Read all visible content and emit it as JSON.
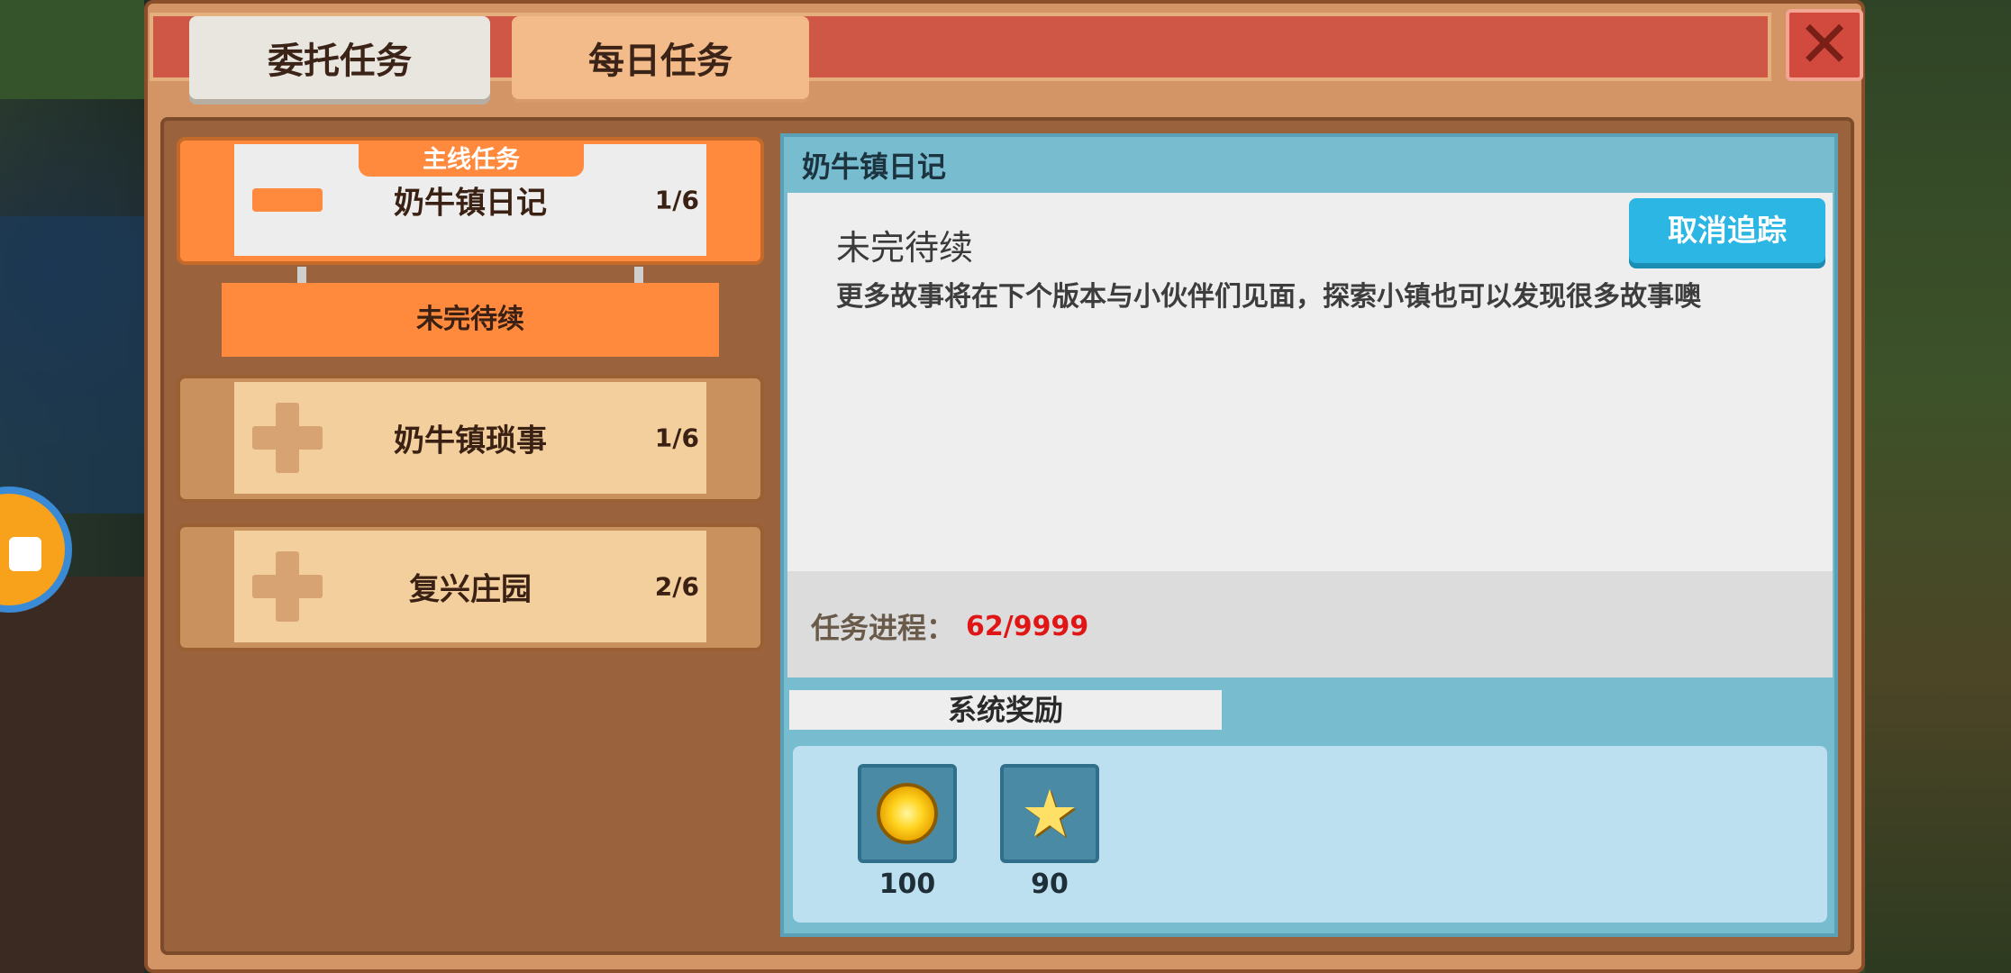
{
  "tabs": [
    {
      "label": "委托任务",
      "active": true
    },
    {
      "label": "每日任务",
      "active": false
    }
  ],
  "quest_list": {
    "active": {
      "tag": "主线任务",
      "name": "奶牛镇日记",
      "count": "1/6",
      "sub_item": "未完待续"
    },
    "items": [
      {
        "name": "奶牛镇琐事",
        "count": "1/6"
      },
      {
        "name": "复兴庄园",
        "count": "2/6"
      }
    ]
  },
  "detail": {
    "title": "奶牛镇日记",
    "quest_title": "未完待续",
    "description": "更多故事将在下个版本与小伙伴们见面，探索小镇也可以发现很多故事噢",
    "cancel_button": "取消追踪",
    "progress_label": "任务进程：",
    "progress_value": "62/9999",
    "reward_tab": "系统奖励",
    "rewards": [
      {
        "icon": "gold-coin-icon",
        "value": "100"
      },
      {
        "icon": "star-icon",
        "value": "90"
      }
    ]
  },
  "colors": {
    "accent_orange": "#ff8a3d",
    "panel_brown": "#d49566",
    "detail_blue": "#78bcd0",
    "cancel_button": "#2bb6e3",
    "progress_red": "#e01616"
  }
}
